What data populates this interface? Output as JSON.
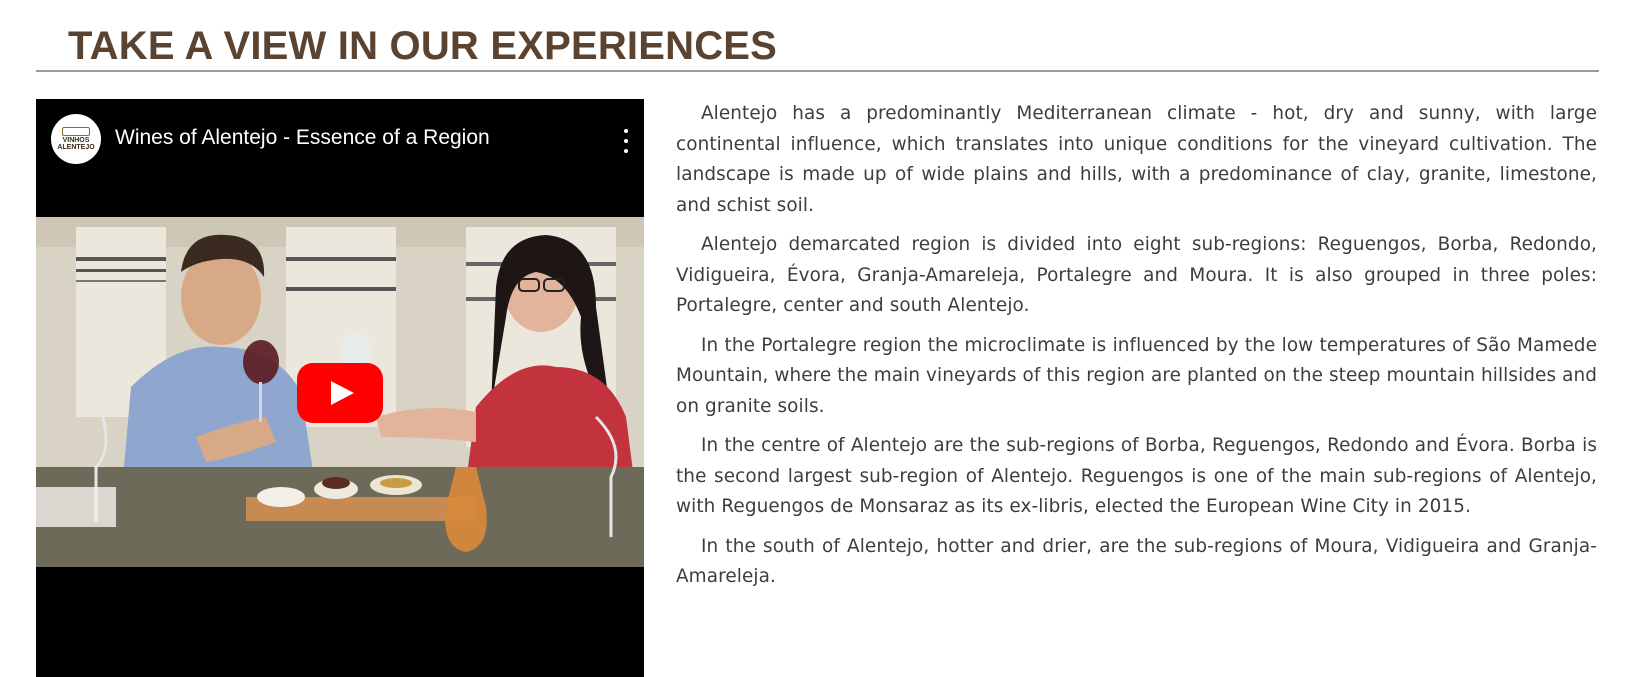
{
  "section": {
    "title": "TAKE A VIEW IN OUR EXPERIENCES"
  },
  "video": {
    "title": "Wines of Alentejo - Essence of a Region",
    "channel_logo_text": "VINHOS ALENTEJO",
    "menu_icon": "more-vertical-icon",
    "play_icon": "youtube-play-icon",
    "play_button_color": "#ff0000"
  },
  "article": {
    "paragraphs": [
      "Alentejo has a predominantly Mediterranean climate - hot, dry and sunny, with large continental influence, which translates into unique conditions for the vineyard cultivation. The landscape is made up of wide plains and hills, with a predominance of clay, granite, limestone, and schist soil.",
      "Alentejo demarcated region is divided into eight sub-regions: Reguengos, Borba, Redondo, Vidigueira, Évora, Granja-Amareleja, Portalegre and Moura. It is also grouped in three poles: Portalegre, center and south Alentejo.",
      "In the Portalegre region the microclimate is influenced by the low temperatures of São Mamede Mountain, where the main vineyards of this region are planted on the steep mountain hillsides and on granite soils.",
      "In the centre of Alentejo are the sub-regions of Borba, Reguengos, Redondo and Évora. Borba is the second largest sub-region of Alentejo. Reguengos is one of the main sub-regions of Alentejo, with Reguengos de Monsaraz as its ex-libris, elected the European Wine City in 2015.",
      "In the south of Alentejo, hotter and drier, are the sub-regions of Moura, Vidigueira and Granja-Amareleja."
    ]
  },
  "colors": {
    "title": "#5a4331",
    "rule": "#9c9c9c",
    "body_text": "#3d3d3d",
    "video_bg": "#000000"
  }
}
